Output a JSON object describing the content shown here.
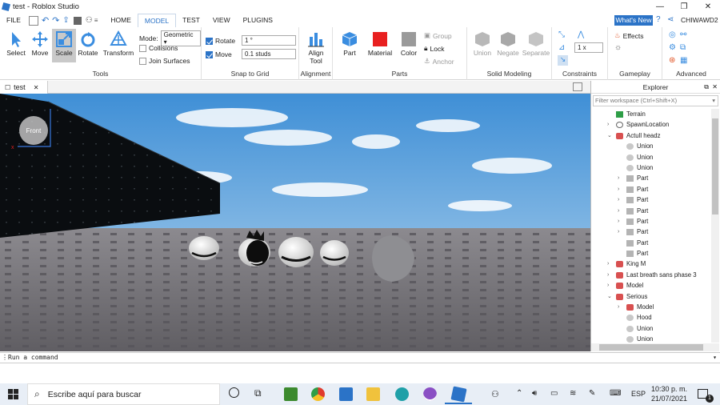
{
  "window": {
    "title": "test - Roblox Studio",
    "minimize": "—",
    "restore": "❐",
    "close": "✕"
  },
  "menu": {
    "file": "FILE",
    "tabs": [
      "HOME",
      "MODEL",
      "TEST",
      "VIEW",
      "PLUGINS"
    ],
    "active_tab": "MODEL",
    "whats_new": "What's New",
    "user": "CHIWAWD2"
  },
  "ribbon": {
    "tools": {
      "select": "Select",
      "move": "Move",
      "scale": "Scale",
      "rotate": "Rotate",
      "transform": "Transform",
      "mode_label": "Mode:",
      "mode_value": "Geometric",
      "collisions": "Collisions",
      "join_surfaces": "Join Surfaces",
      "group_label": "Tools"
    },
    "snap": {
      "rotate_label": "Rotate",
      "rotate_value": "1 °",
      "move_label": "Move",
      "move_value": "0.1 studs",
      "group_label": "Snap to Grid"
    },
    "alignment": {
      "align_tool": "Align Tool",
      "group_label": "Alignment"
    },
    "parts": {
      "part": "Part",
      "material": "Material",
      "color": "Color",
      "group": "Group",
      "lock": "Lock",
      "anchor": "Anchor",
      "group_label": "Parts"
    },
    "solid": {
      "union": "Union",
      "negate": "Negate",
      "separate": "Separate",
      "group_label": "Solid Modeling"
    },
    "constraints": {
      "count": "1 x",
      "group_label": "Constraints"
    },
    "gameplay": {
      "effects": "Effects",
      "group_label": "Gameplay"
    },
    "advanced": {
      "group_label": "Advanced"
    }
  },
  "document": {
    "tab_label": "test"
  },
  "viewport": {
    "view_cube_label": "Front"
  },
  "explorer": {
    "title": "Explorer",
    "filter_placeholder": "Filter workspace (Ctrl+Shift+X)",
    "items": [
      {
        "label": "Terrain",
        "indent": 1,
        "arrow": "",
        "icon": "terrain-icon"
      },
      {
        "label": "SpawnLocation",
        "indent": 1,
        "arrow": "›",
        "icon": "spawn-icon"
      },
      {
        "label": "Actull headz",
        "indent": 1,
        "arrow": "⌄",
        "icon": "model-icon"
      },
      {
        "label": "Union",
        "indent": 2,
        "arrow": "",
        "icon": "union-icon"
      },
      {
        "label": "Union",
        "indent": 2,
        "arrow": "",
        "icon": "union-icon"
      },
      {
        "label": "Union",
        "indent": 2,
        "arrow": "",
        "icon": "union-icon"
      },
      {
        "label": "Part",
        "indent": 2,
        "arrow": "›",
        "icon": "part-icon"
      },
      {
        "label": "Part",
        "indent": 2,
        "arrow": "›",
        "icon": "part-icon"
      },
      {
        "label": "Part",
        "indent": 2,
        "arrow": "›",
        "icon": "part-icon"
      },
      {
        "label": "Part",
        "indent": 2,
        "arrow": "›",
        "icon": "part-icon"
      },
      {
        "label": "Part",
        "indent": 2,
        "arrow": "›",
        "icon": "part-icon"
      },
      {
        "label": "Part",
        "indent": 2,
        "arrow": "›",
        "icon": "part-icon"
      },
      {
        "label": "Part",
        "indent": 2,
        "arrow": "",
        "icon": "part-icon"
      },
      {
        "label": "Part",
        "indent": 2,
        "arrow": "",
        "icon": "part-icon"
      },
      {
        "label": "King M",
        "indent": 1,
        "arrow": "›",
        "icon": "model-icon"
      },
      {
        "label": "Last breath sans phase 3",
        "indent": 1,
        "arrow": "›",
        "icon": "model-icon"
      },
      {
        "label": "Model",
        "indent": 1,
        "arrow": "›",
        "icon": "model-icon"
      },
      {
        "label": "Serious",
        "indent": 1,
        "arrow": "⌄",
        "icon": "model-icon"
      },
      {
        "label": "Model",
        "indent": 2,
        "arrow": "›",
        "icon": "model-icon"
      },
      {
        "label": "Hood",
        "indent": 2,
        "arrow": "",
        "icon": "union-icon"
      },
      {
        "label": "Union",
        "indent": 2,
        "arrow": "",
        "icon": "union-icon"
      },
      {
        "label": "Union",
        "indent": 2,
        "arrow": "",
        "icon": "union-icon"
      }
    ]
  },
  "command_bar": {
    "placeholder": "Run a command"
  },
  "taskbar": {
    "search_placeholder": "Escribe aquí para buscar",
    "language": "ESP",
    "time": "10:30 p. m.",
    "date": "21/07/2021",
    "notifications": "1"
  },
  "colors": {
    "accent": "#2b73c7",
    "sky_top": "#3f8fd6",
    "ground": "#6e6c70",
    "taskbar": "#e8eef6"
  }
}
